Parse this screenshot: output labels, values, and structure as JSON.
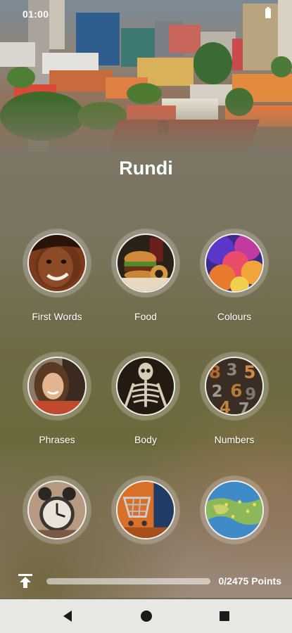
{
  "status_bar": {
    "time": "01:00",
    "battery_icon": "battery-icon"
  },
  "app": {
    "title": "Rundi"
  },
  "categories": [
    {
      "label": "First Words",
      "icon": "child-face-photo"
    },
    {
      "label": "Food",
      "icon": "burger-photo"
    },
    {
      "label": "Colours",
      "icon": "color-powder-photo"
    },
    {
      "label": "Phrases",
      "icon": "smiling-woman-photo"
    },
    {
      "label": "Body",
      "icon": "skeleton-photo"
    },
    {
      "label": "Numbers",
      "icon": "metal-numbers-photo"
    },
    {
      "label": "",
      "icon": "alarm-clock-photo"
    },
    {
      "label": "",
      "icon": "shopping-cart-photo"
    },
    {
      "label": "",
      "icon": "world-map-photo"
    }
  ],
  "progress": {
    "points_text": "0/2475 Points",
    "fraction": 0,
    "icon": "upload-arrow-icon"
  },
  "nav_bar": {
    "back": "back-triangle-icon",
    "home": "home-circle-icon",
    "recents": "recents-square-icon"
  },
  "colors": {
    "text": "#ffffff",
    "navbar_bg": "#e9e7e4",
    "nav_icon": "#1a1a1a"
  }
}
